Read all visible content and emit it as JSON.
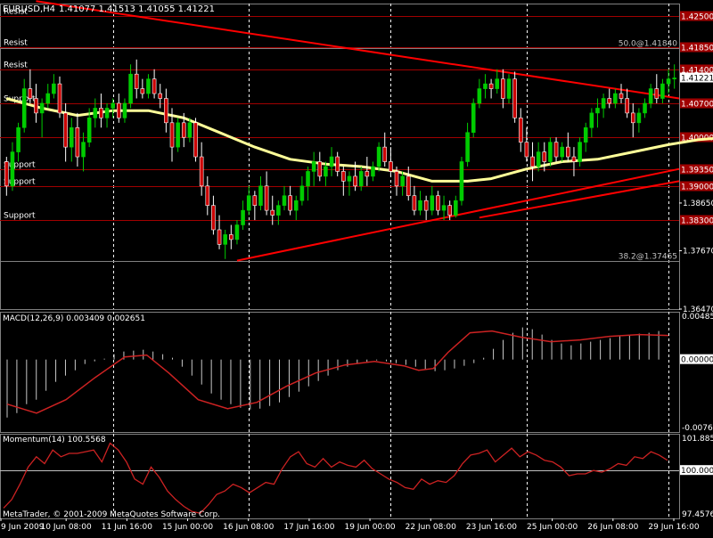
{
  "window": {
    "symbol_header": "EURUSD,H4",
    "ohlc": "1.41077 1.41513 1.41055 1.41221",
    "copyright": "MetaTrader, © 2001-2009 MetaQuotes Software Corp."
  },
  "colors": {
    "background": "#000000",
    "grid_line": "#ffffff",
    "bull_candle": "#00cc00",
    "bear_candle": "#cc0000",
    "level_line": "#a00000",
    "trend_line": "#ff0000",
    "moving_average": "#ffff99",
    "macd_histogram": "#c8c8c8",
    "signal_line": "#cc2222",
    "momentum_line": "#cc2222",
    "text": "#ffffff",
    "current_price_label_bg": "#ffffff",
    "current_price_label_fg": "#000000"
  },
  "chart_data": [
    {
      "type": "candlestick",
      "title": "EURUSD,H4",
      "y_ticks": [
        "1.42500",
        "1.41850",
        "1.41400",
        "1.41221",
        "1.40700",
        "1.40000",
        "1.39350",
        "1.38650",
        "1.37670",
        "1.36470"
      ],
      "ylim": [
        1.3647,
        1.4275
      ],
      "x_ticks": [
        "9 Jun 2009",
        "10 Jun 08:00",
        "11 Jun 16:00",
        "15 Jun 00:00",
        "16 Jun 08:00",
        "17 Jun 16:00",
        "19 Jun 00:00",
        "22 Jun 08:00",
        "23 Jun 16:00",
        "25 Jun 00:00",
        "26 Jun 08:00",
        "29 Jun 16:00"
      ],
      "current_price": "1.41221",
      "horizontal_levels": [
        {
          "label": "Resist",
          "price_label": "1.42500",
          "value": 1.425
        },
        {
          "label": "Resist",
          "price_label": "1.41850",
          "value": 1.4185
        },
        {
          "label": "Resist",
          "price_label": "1.41400",
          "value": 1.414
        },
        {
          "label": "Support",
          "price_label": "1.40700",
          "value": 1.407
        },
        {
          "label": "",
          "price_label": "1.40000",
          "value": 1.4
        },
        {
          "label": "Support",
          "price_label": "1.39350",
          "value": 1.3935
        },
        {
          "label": "Support",
          "price_label": "1.39000",
          "value": 1.39
        },
        {
          "label": "Support",
          "price_label": "1.38300",
          "value": 1.383
        }
      ],
      "fib_labels": [
        {
          "text": "50.0@1.41840",
          "value": 1.4184
        },
        {
          "text": "38.2@1.37465",
          "value": 1.37465
        }
      ],
      "trend_lines": [
        {
          "from": [
            5,
            1.428
          ],
          "to": [
            122,
            1.408
          ]
        },
        {
          "from": [
            39,
            1.37465
          ],
          "to": [
            122,
            1.3935
          ]
        },
        {
          "from": [
            80,
            1.3835
          ],
          "to": [
            122,
            1.391
          ]
        }
      ],
      "candles": [
        [
          1.395,
          1.396,
          1.388,
          1.39
        ],
        [
          1.39,
          1.399,
          1.389,
          1.397
        ],
        [
          1.397,
          1.403,
          1.395,
          1.402
        ],
        [
          1.402,
          1.412,
          1.401,
          1.41
        ],
        [
          1.41,
          1.414,
          1.407,
          1.408
        ],
        [
          1.408,
          1.411,
          1.403,
          1.405
        ],
        [
          1.405,
          1.408,
          1.4,
          1.407
        ],
        [
          1.407,
          1.411,
          1.406,
          1.409
        ],
        [
          1.409,
          1.413,
          1.408,
          1.411
        ],
        [
          1.411,
          1.4125,
          1.404,
          1.405
        ],
        [
          1.405,
          1.407,
          1.395,
          1.398
        ],
        [
          1.398,
          1.404,
          1.395,
          1.402
        ],
        [
          1.402,
          1.405,
          1.394,
          1.396
        ],
        [
          1.396,
          1.401,
          1.393,
          1.399
        ],
        [
          1.399,
          1.406,
          1.398,
          1.404
        ],
        [
          1.404,
          1.408,
          1.402,
          1.406
        ],
        [
          1.406,
          1.409,
          1.402,
          1.404
        ],
        [
          1.404,
          1.407,
          1.402,
          1.406
        ],
        [
          1.406,
          1.408,
          1.404,
          1.407
        ],
        [
          1.407,
          1.409,
          1.403,
          1.404
        ],
        [
          1.404,
          1.408,
          1.403,
          1.407
        ],
        [
          1.407,
          1.415,
          1.406,
          1.413
        ],
        [
          1.413,
          1.416,
          1.408,
          1.41
        ],
        [
          1.41,
          1.412,
          1.408,
          1.409
        ],
        [
          1.409,
          1.413,
          1.408,
          1.412
        ],
        [
          1.412,
          1.414,
          1.408,
          1.409
        ],
        [
          1.409,
          1.411,
          1.406,
          1.408
        ],
        [
          1.408,
          1.41,
          1.401,
          1.403
        ],
        [
          1.403,
          1.406,
          1.395,
          1.398
        ],
        [
          1.398,
          1.404,
          1.397,
          1.403
        ],
        [
          1.403,
          1.405,
          1.398,
          1.4
        ],
        [
          1.4,
          1.404,
          1.399,
          1.403
        ],
        [
          1.403,
          1.404,
          1.395,
          1.396
        ],
        [
          1.396,
          1.399,
          1.388,
          1.39
        ],
        [
          1.39,
          1.392,
          1.384,
          1.386
        ],
        [
          1.386,
          1.388,
          1.38,
          1.381
        ],
        [
          1.381,
          1.384,
          1.377,
          1.378
        ],
        [
          1.378,
          1.381,
          1.375,
          1.38
        ],
        [
          1.38,
          1.382,
          1.377,
          1.379
        ],
        [
          1.379,
          1.383,
          1.378,
          1.382
        ],
        [
          1.382,
          1.387,
          1.381,
          1.385
        ],
        [
          1.385,
          1.39,
          1.384,
          1.388
        ],
        [
          1.388,
          1.389,
          1.383,
          1.386
        ],
        [
          1.386,
          1.392,
          1.385,
          1.39
        ],
        [
          1.39,
          1.393,
          1.384,
          1.385
        ],
        [
          1.385,
          1.388,
          1.382,
          1.384
        ],
        [
          1.384,
          1.387,
          1.382,
          1.386
        ],
        [
          1.386,
          1.39,
          1.385,
          1.388
        ],
        [
          1.388,
          1.39,
          1.384,
          1.385
        ],
        [
          1.385,
          1.388,
          1.383,
          1.387
        ],
        [
          1.387,
          1.392,
          1.386,
          1.39
        ],
        [
          1.39,
          1.394,
          1.387,
          1.393
        ],
        [
          1.393,
          1.397,
          1.39,
          1.395
        ],
        [
          1.395,
          1.397,
          1.391,
          1.392
        ],
        [
          1.392,
          1.395,
          1.39,
          1.394
        ],
        [
          1.394,
          1.398,
          1.392,
          1.396
        ],
        [
          1.396,
          1.397,
          1.392,
          1.393
        ],
        [
          1.393,
          1.394,
          1.388,
          1.391
        ],
        [
          1.391,
          1.393,
          1.388,
          1.392
        ],
        [
          1.392,
          1.395,
          1.389,
          1.39
        ],
        [
          1.39,
          1.394,
          1.389,
          1.393
        ],
        [
          1.393,
          1.396,
          1.39,
          1.392
        ],
        [
          1.392,
          1.395,
          1.391,
          1.394
        ],
        [
          1.394,
          1.399,
          1.393,
          1.398
        ],
        [
          1.398,
          1.401,
          1.394,
          1.395
        ],
        [
          1.395,
          1.398,
          1.392,
          1.393
        ],
        [
          1.393,
          1.394,
          1.388,
          1.39
        ],
        [
          1.39,
          1.393,
          1.388,
          1.392
        ],
        [
          1.392,
          1.394,
          1.387,
          1.388
        ],
        [
          1.388,
          1.39,
          1.384,
          1.385
        ],
        [
          1.385,
          1.389,
          1.384,
          1.387
        ],
        [
          1.387,
          1.388,
          1.383,
          1.385
        ],
        [
          1.385,
          1.39,
          1.384,
          1.388
        ],
        [
          1.388,
          1.389,
          1.384,
          1.385
        ],
        [
          1.385,
          1.388,
          1.383,
          1.386
        ],
        [
          1.386,
          1.387,
          1.383,
          1.384
        ],
        [
          1.384,
          1.388,
          1.3835,
          1.387
        ],
        [
          1.387,
          1.396,
          1.386,
          1.395
        ],
        [
          1.395,
          1.403,
          1.394,
          1.401
        ],
        [
          1.401,
          1.408,
          1.4,
          1.407
        ],
        [
          1.407,
          1.412,
          1.406,
          1.41
        ],
        [
          1.41,
          1.413,
          1.408,
          1.411
        ],
        [
          1.411,
          1.412,
          1.408,
          1.41
        ],
        [
          1.41,
          1.414,
          1.409,
          1.412
        ],
        [
          1.412,
          1.414,
          1.406,
          1.408
        ],
        [
          1.408,
          1.413,
          1.407,
          1.412
        ],
        [
          1.412,
          1.4135,
          1.403,
          1.404
        ],
        [
          1.404,
          1.406,
          1.397,
          1.399
        ],
        [
          1.399,
          1.402,
          1.395,
          1.396
        ],
        [
          1.396,
          1.399,
          1.391,
          1.394
        ],
        [
          1.394,
          1.399,
          1.393,
          1.397
        ],
        [
          1.397,
          1.399,
          1.393,
          1.395
        ],
        [
          1.395,
          1.4,
          1.394,
          1.399
        ],
        [
          1.399,
          1.4,
          1.395,
          1.396
        ],
        [
          1.396,
          1.399,
          1.395,
          1.398
        ],
        [
          1.398,
          1.401,
          1.395,
          1.396
        ],
        [
          1.396,
          1.398,
          1.392,
          1.395
        ],
        [
          1.395,
          1.4,
          1.394,
          1.399
        ],
        [
          1.399,
          1.403,
          1.397,
          1.402
        ],
        [
          1.402,
          1.406,
          1.4,
          1.405
        ],
        [
          1.405,
          1.408,
          1.402,
          1.406
        ],
        [
          1.406,
          1.409,
          1.404,
          1.408
        ],
        [
          1.408,
          1.41,
          1.406,
          1.407
        ],
        [
          1.407,
          1.41,
          1.406,
          1.409
        ],
        [
          1.409,
          1.411,
          1.407,
          1.408
        ],
        [
          1.408,
          1.41,
          1.404,
          1.405
        ],
        [
          1.405,
          1.407,
          1.4,
          1.403
        ],
        [
          1.403,
          1.406,
          1.401,
          1.405
        ],
        [
          1.405,
          1.408,
          1.404,
          1.407
        ],
        [
          1.407,
          1.411,
          1.406,
          1.41
        ],
        [
          1.41,
          1.413,
          1.407,
          1.408
        ],
        [
          1.408,
          1.412,
          1.407,
          1.411
        ],
        [
          1.411,
          1.414,
          1.409,
          1.412
        ],
        [
          1.412,
          1.415,
          1.41,
          1.4122
        ]
      ],
      "moving_average": [
        [
          0,
          1.408
        ],
        [
          6,
          1.406
        ],
        [
          12,
          1.4045
        ],
        [
          18,
          1.4055
        ],
        [
          24,
          1.4055
        ],
        [
          30,
          1.404
        ],
        [
          36,
          1.401
        ],
        [
          42,
          1.398
        ],
        [
          48,
          1.3955
        ],
        [
          54,
          1.3945
        ],
        [
          60,
          1.394
        ],
        [
          66,
          1.393
        ],
        [
          72,
          1.391
        ],
        [
          78,
          1.391
        ],
        [
          82,
          1.3915
        ],
        [
          88,
          1.3935
        ],
        [
          94,
          1.395
        ],
        [
          100,
          1.3955
        ],
        [
          106,
          1.397
        ],
        [
          112,
          1.3985
        ],
        [
          117,
          1.3995
        ],
        [
          122,
          1.4
        ]
      ]
    },
    {
      "type": "bar",
      "title": "MACD(12,26,9) 0.003409 0.002651",
      "y_ticks": [
        "0.004857",
        "0.00000",
        "-0.007621"
      ],
      "ylim": [
        -0.007621,
        0.004857
      ],
      "histogram": [
        -0.0065,
        -0.006,
        -0.005,
        -0.0045,
        -0.0035,
        -0.0025,
        -0.0018,
        -0.0012,
        -0.0005,
        -0.0002,
        0.0001,
        0.0006,
        0.0009,
        0.001,
        0.0011,
        0.0009,
        0.0006,
        0.0002,
        -0.0008,
        -0.0018,
        -0.0028,
        -0.0038,
        -0.0045,
        -0.005,
        -0.0054,
        -0.0056,
        -0.0055,
        -0.0052,
        -0.0048,
        -0.0042,
        -0.0036,
        -0.003,
        -0.0024,
        -0.0018,
        -0.0012,
        -0.0008,
        -0.0005,
        -0.0003,
        -0.0001,
        -0.0002,
        -0.0004,
        -0.0006,
        -0.0008,
        -0.0011,
        -0.0013,
        -0.0012,
        -0.001,
        -0.0007,
        -0.0004,
        0.0002,
        0.0012,
        0.0022,
        0.003,
        0.0036,
        0.0034,
        0.0028,
        0.0022,
        0.0018,
        0.0016,
        0.0018,
        0.002,
        0.0022,
        0.0024,
        0.0026,
        0.0027,
        0.0029,
        0.003,
        0.0032
      ],
      "signal_line": [
        [
          0,
          -0.005
        ],
        [
          4,
          -0.006
        ],
        [
          8,
          -0.0045
        ],
        [
          12,
          -0.002
        ],
        [
          16,
          0.0003
        ],
        [
          19,
          0.0005
        ],
        [
          22,
          -0.0015
        ],
        [
          26,
          -0.0045
        ],
        [
          30,
          -0.0055
        ],
        [
          34,
          -0.0048
        ],
        [
          38,
          -0.003
        ],
        [
          42,
          -0.0015
        ],
        [
          46,
          -0.0006
        ],
        [
          50,
          -0.0002
        ],
        [
          54,
          -0.0007
        ],
        [
          56,
          -0.0012
        ],
        [
          58,
          -0.001
        ],
        [
          60,
          0.0008
        ],
        [
          63,
          0.003
        ],
        [
          66,
          0.0032
        ],
        [
          70,
          0.0025
        ],
        [
          74,
          0.002
        ],
        [
          78,
          0.0022
        ],
        [
          82,
          0.0026
        ],
        [
          86,
          0.0028
        ],
        [
          90,
          0.0027
        ]
      ]
    },
    {
      "type": "line",
      "title": "Momentum(14) 100.5568",
      "y_ticks": [
        "101.8859",
        "100.0000",
        "97.4576"
      ],
      "ylim": [
        97.4576,
        101.8859
      ],
      "series": [
        {
          "values": [
            97.8,
            98.3,
            99.2,
            100.2,
            100.8,
            100.4,
            101.2,
            100.8,
            101.0,
            101.0,
            101.1,
            101.2,
            100.5,
            101.6,
            101.2,
            100.5,
            99.5,
            99.2,
            100.2,
            99.6,
            98.8,
            98.3,
            97.9,
            97.6,
            97.5,
            98.0,
            98.6,
            98.8,
            99.2,
            99.0,
            98.7,
            99.0,
            99.3,
            99.2,
            100.1,
            100.8,
            101.1,
            100.4,
            100.2,
            100.7,
            100.2,
            100.5,
            100.3,
            100.2,
            100.6,
            100.1,
            99.8,
            99.5,
            99.3,
            99.0,
            98.9,
            99.5,
            99.2,
            99.4,
            99.3,
            99.7,
            100.4,
            100.9,
            101.0,
            101.2,
            100.5,
            100.9,
            101.3,
            100.8,
            101.1,
            100.9,
            100.6,
            100.5,
            100.2,
            99.7,
            99.8,
            99.8,
            100.0,
            99.9,
            100.1,
            100.4,
            100.3,
            100.8,
            100.7,
            101.1,
            100.9,
            100.6
          ]
        }
      ]
    }
  ]
}
